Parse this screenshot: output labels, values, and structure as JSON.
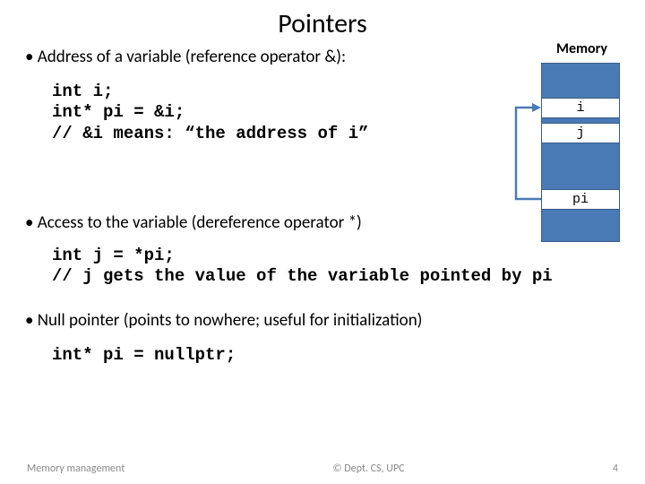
{
  "title": "Pointers",
  "memory_label": "Memory",
  "bullet1": "Address of a variable (reference operator &):",
  "code1_l1": "int i;",
  "code1_l2": "int* pi = &i;",
  "code1_l3": "// &i means: “the address of i”",
  "bullet2": "Access to the variable (dereference operator *)",
  "code2_l1": "int j = *pi;",
  "code2_l2": "// j gets the value of the variable pointed by pi",
  "bullet3": "Null pointer (points to nowhere; useful for initialization)",
  "code3_l1": "int* pi = nullptr;",
  "memory": {
    "cell_i": "i",
    "cell_j": "j",
    "cell_pi": "pi"
  },
  "footer": {
    "left": "Memory management",
    "center": "© Dept. CS, UPC",
    "right": "4"
  }
}
